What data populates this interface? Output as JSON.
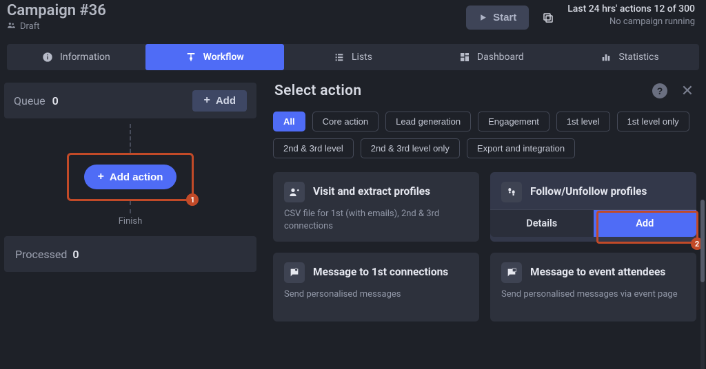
{
  "header": {
    "title": "Campaign #36",
    "status": "Draft",
    "start_label": "Start",
    "stats_line1": "Last 24 hrs' actions 12 of 300",
    "stats_line2": "No campaign running"
  },
  "tabs": {
    "information": "Information",
    "workflow": "Workflow",
    "lists": "Lists",
    "dashboard": "Dashboard",
    "statistics": "Statistics"
  },
  "workflow": {
    "queue_label": "Queue",
    "queue_count": "0",
    "add_btn": "Add",
    "add_action_btn": "Add action",
    "finish_label": "Finish",
    "processed_label": "Processed",
    "processed_count": "0",
    "annotation1": "1"
  },
  "panel": {
    "title": "Select action",
    "help": "?",
    "close": "✕",
    "filters": {
      "all": "All",
      "core": "Core action",
      "leadgen": "Lead generation",
      "engagement": "Engagement",
      "first": "1st level",
      "first_only": "1st level only",
      "second_third": "2nd & 3rd level",
      "second_third_only": "2nd & 3rd level only",
      "export": "Export and integration"
    },
    "cards": {
      "visit": {
        "title": "Visit and extract profiles",
        "desc": "CSV file for 1st (with emails), 2nd & 3rd connections"
      },
      "follow": {
        "title": "Follow/Unfollow profiles",
        "details": "Details",
        "add": "Add",
        "annotation2": "2"
      },
      "message1": {
        "title": "Message to 1st connections",
        "desc": "Send personalised messages"
      },
      "message_event": {
        "title": "Message to event attendees",
        "desc": "Send personalised messages via event page"
      }
    }
  }
}
